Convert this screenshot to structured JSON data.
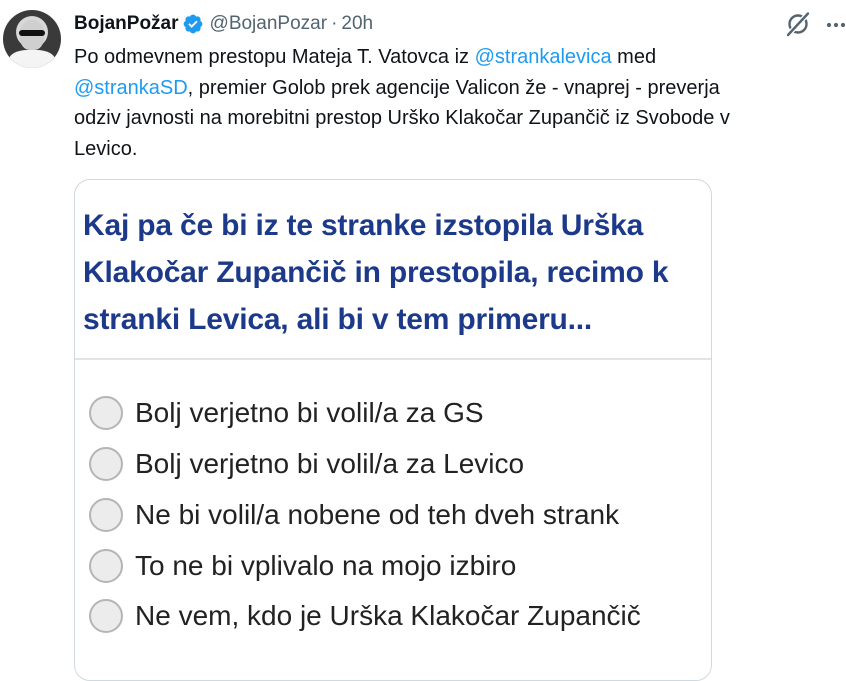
{
  "tweet": {
    "author_name": "BojanPožar",
    "handle": "@BojanPozar",
    "separator": "·",
    "time": "20h",
    "text": {
      "part1": "Po odmevnem prestopu Mateja T. Vatovca iz ",
      "mention1": "@strankalevica",
      "part2": " med\n",
      "mention2": "@strankaSD",
      "part3": ", premier Golob prek agencije Valicon že - vnaprej - preverja\nodziv javnosti na morebitni prestop Urško Klakočar Zupančič iz Svobode v\nLevico."
    }
  },
  "card": {
    "question_lines": [
      "Kaj pa če bi iz te stranke izstopila Urška",
      "Klakočar Zupančič in prestopila, recimo k",
      "stranki Levica, ali bi v tem primeru..."
    ],
    "options": [
      "Bolj verjetno bi volil/a za GS",
      "Bolj verjetno bi volil/a za Levico",
      "Ne bi volil/a nobene od teh dveh strank",
      "To ne bi vplivalo na mojo izbiro",
      "Ne vem, kdo je Urška Klakočar Zupančič"
    ]
  },
  "icons": {
    "verified": "verified-badge-icon",
    "grok": "grok-icon",
    "more": "more-options-icon"
  },
  "colors": {
    "link": "#1d9bf0",
    "verified": "#1d9bf0",
    "question": "#1d3a8a",
    "secondary_text": "#536471"
  }
}
